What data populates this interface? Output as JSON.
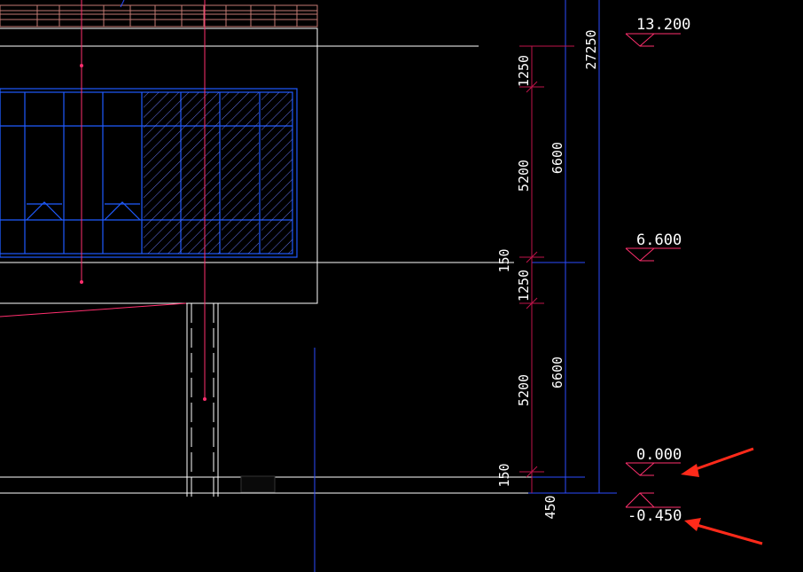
{
  "drawing": {
    "colors": {
      "background": "#000000",
      "outline": "#ffffff",
      "window_frame": "#1f5bff",
      "window_hatch": "#6e7dff",
      "railing": "#c47a73",
      "centerline": "#ff2f6e",
      "dimension_line": "#c0144a",
      "dimension_text": "#ffffff",
      "level_marker": "#ff2f6e",
      "blue_guide": "#2b4bff",
      "annotation_arrow": "#ff2a1a"
    },
    "dimensions_inner": [
      "1250",
      "5200",
      "150",
      "1250",
      "5200",
      "150",
      "450"
    ],
    "dimensions_outer": [
      "6600",
      "6600"
    ],
    "dimension_total": "27250",
    "elevation_levels": [
      {
        "value": "13.200"
      },
      {
        "value": "6.600"
      },
      {
        "value": "0.000",
        "highlighted": true
      },
      {
        "value": "-0.450",
        "highlighted": true
      }
    ],
    "annotation_arrows": [
      {
        "target": "0.000",
        "icon": "red-arrow-icon"
      },
      {
        "target": "-0.450",
        "icon": "red-arrow-icon"
      }
    ]
  }
}
